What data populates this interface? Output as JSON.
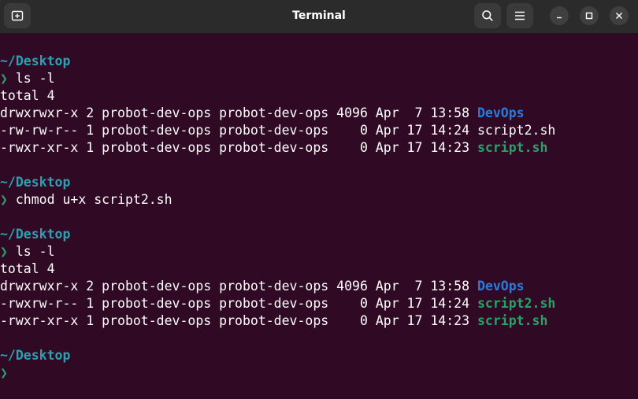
{
  "window": {
    "title": "Terminal",
    "icons": {
      "new_tab": "new-tab-icon",
      "search": "search-icon",
      "menu": "hamburger-menu-icon",
      "minimize": "minimize-icon",
      "maximize": "maximize-icon",
      "close": "close-icon"
    }
  },
  "colors": {
    "background": "#300a24",
    "path": "#2aa1b3",
    "prompt": "#26a269",
    "directory": "#2a7bde",
    "executable": "#26a269",
    "text": "#ffffff"
  },
  "terminal": {
    "blocks": [
      {
        "path": "~/Desktop",
        "prompt": "❯",
        "command": "ls -l",
        "output": {
          "total": "total 4",
          "rows": [
            {
              "meta": "drwxrwxr-x 2 probot-dev-ops probot-dev-ops 4096 Apr  7 13:58 ",
              "name": "DevOps",
              "kind": "dir"
            },
            {
              "meta": "-rw-rw-r-- 1 probot-dev-ops probot-dev-ops    0 Apr 17 14:24 ",
              "name": "script2.sh",
              "kind": "plain"
            },
            {
              "meta": "-rwxr-xr-x 1 probot-dev-ops probot-dev-ops    0 Apr 17 14:23 ",
              "name": "script.sh",
              "kind": "exec"
            }
          ]
        }
      },
      {
        "path": "~/Desktop",
        "prompt": "❯",
        "command": "chmod u+x script2.sh"
      },
      {
        "path": "~/Desktop",
        "prompt": "❯",
        "command": "ls -l",
        "output": {
          "total": "total 4",
          "rows": [
            {
              "meta": "drwxrwxr-x 2 probot-dev-ops probot-dev-ops 4096 Apr  7 13:58 ",
              "name": "DevOps",
              "kind": "dir"
            },
            {
              "meta": "-rwxrw-r-- 1 probot-dev-ops probot-dev-ops    0 Apr 17 14:24 ",
              "name": "script2.sh",
              "kind": "exec"
            },
            {
              "meta": "-rwxr-xr-x 1 probot-dev-ops probot-dev-ops    0 Apr 17 14:23 ",
              "name": "script.sh",
              "kind": "exec"
            }
          ]
        }
      },
      {
        "path": "~/Desktop",
        "prompt": "❯",
        "command": ""
      }
    ]
  }
}
